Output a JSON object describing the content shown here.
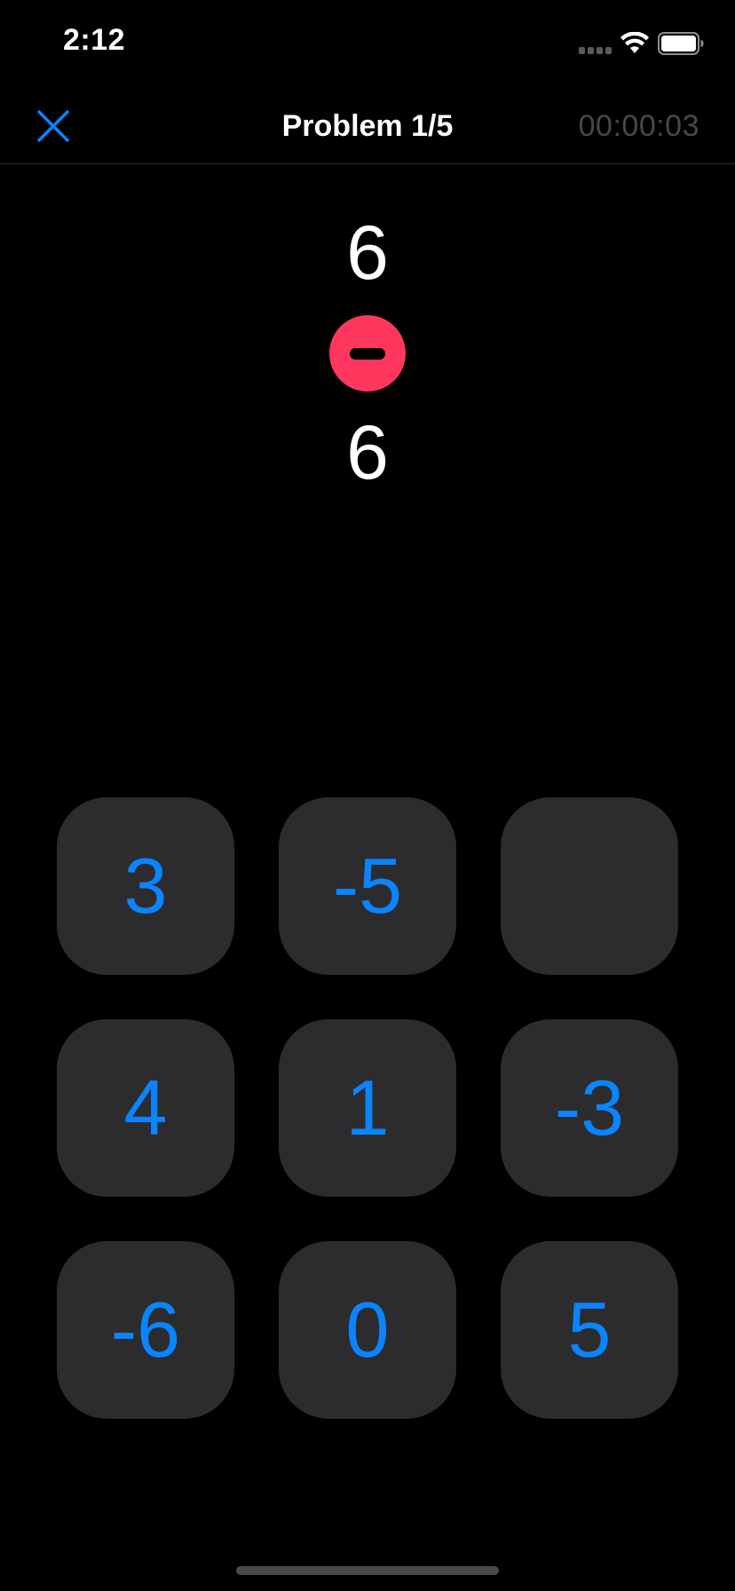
{
  "status_bar": {
    "time": "2:12",
    "icons": [
      "signal-icon",
      "wifi-icon",
      "battery-icon"
    ]
  },
  "nav": {
    "close_icon": "close-icon",
    "title": "Problem 1/5",
    "timer": "00:00:03"
  },
  "problem": {
    "operand_top": "6",
    "operator": "minus",
    "operand_bottom": "6"
  },
  "keypad": {
    "keys": [
      "3",
      "-5",
      "",
      "4",
      "1",
      "-3",
      "-6",
      "0",
      "5"
    ]
  },
  "colors": {
    "background": "#000000",
    "accent": "#0a84ff",
    "operator": "#ff375f",
    "key_background": "#2c2c2e",
    "timer_text": "#48484a"
  }
}
